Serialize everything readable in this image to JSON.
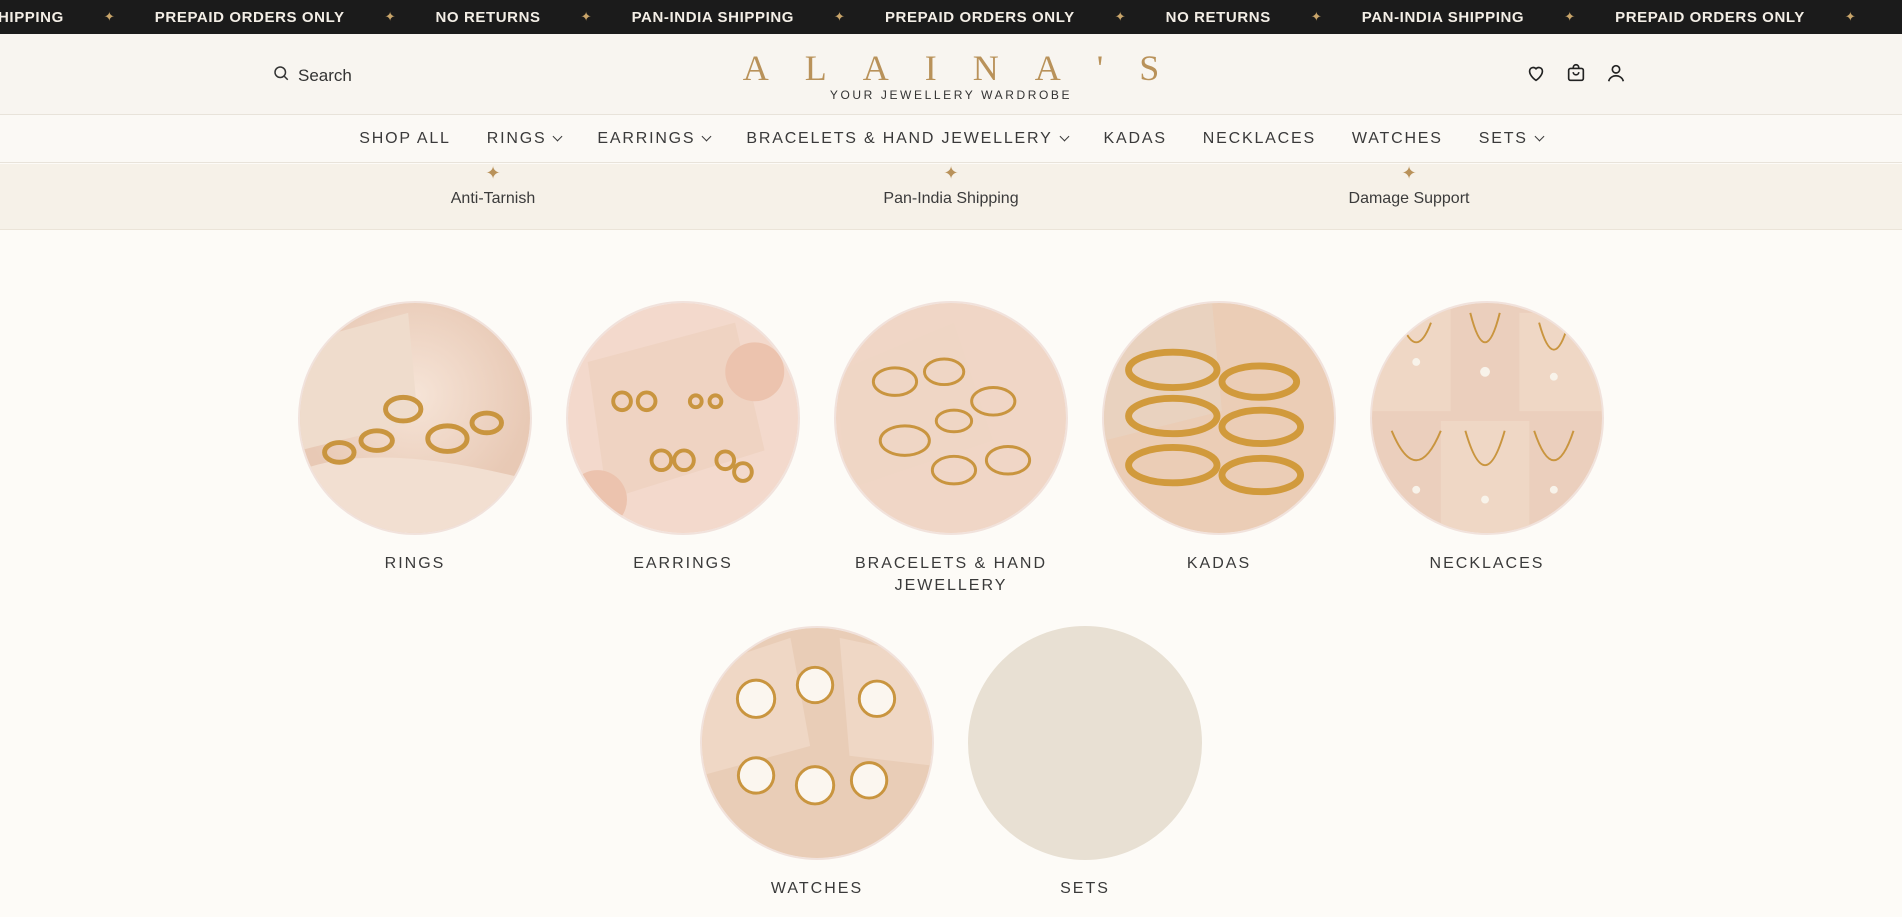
{
  "marquee": {
    "items": [
      "HIPPING",
      "PREPAID ORDERS ONLY",
      "NO RETURNS",
      "PAN-INDIA SHIPPING",
      "PREPAID ORDERS ONLY",
      "NO RETURNS",
      "PAN-INDIA SHIPPING",
      "PREPAID ORDERS ONLY"
    ]
  },
  "header": {
    "search_label": "Search",
    "logo_name": "ALAINA'S",
    "logo_tagline": "YOUR JEWELLERY WARDROBE"
  },
  "nav": {
    "items": [
      {
        "label": "SHOP ALL",
        "dropdown": false
      },
      {
        "label": "RINGS",
        "dropdown": true
      },
      {
        "label": "EARRINGS",
        "dropdown": true
      },
      {
        "label": "BRACELETS & HAND JEWELLERY",
        "dropdown": true
      },
      {
        "label": "KADAS",
        "dropdown": false
      },
      {
        "label": "NECKLACES",
        "dropdown": false
      },
      {
        "label": "WATCHES",
        "dropdown": false
      },
      {
        "label": "SETS",
        "dropdown": true
      }
    ]
  },
  "features": [
    "Anti-Tarnish",
    "Pan-India Shipping",
    "Damage Support"
  ],
  "categories": [
    {
      "label": "RINGS",
      "image": "rings-photo"
    },
    {
      "label": "EARRINGS",
      "image": "earrings-photo"
    },
    {
      "label": "BRACELETS & HAND JEWELLERY",
      "image": "bracelets-photo"
    },
    {
      "label": "KADAS",
      "image": "kadas-photo"
    },
    {
      "label": "NECKLACES",
      "image": "necklaces-photo"
    },
    {
      "label": "WATCHES",
      "image": "watches-photo"
    },
    {
      "label": "SETS",
      "image": "sets-placeholder"
    }
  ],
  "colors": {
    "gold": "#b9925a",
    "marquee_bg": "#1b1b1b",
    "feature_bg": "#f6f1e8",
    "page_bg": "#fdfbf7",
    "placeholder": "#e8e0d3"
  }
}
